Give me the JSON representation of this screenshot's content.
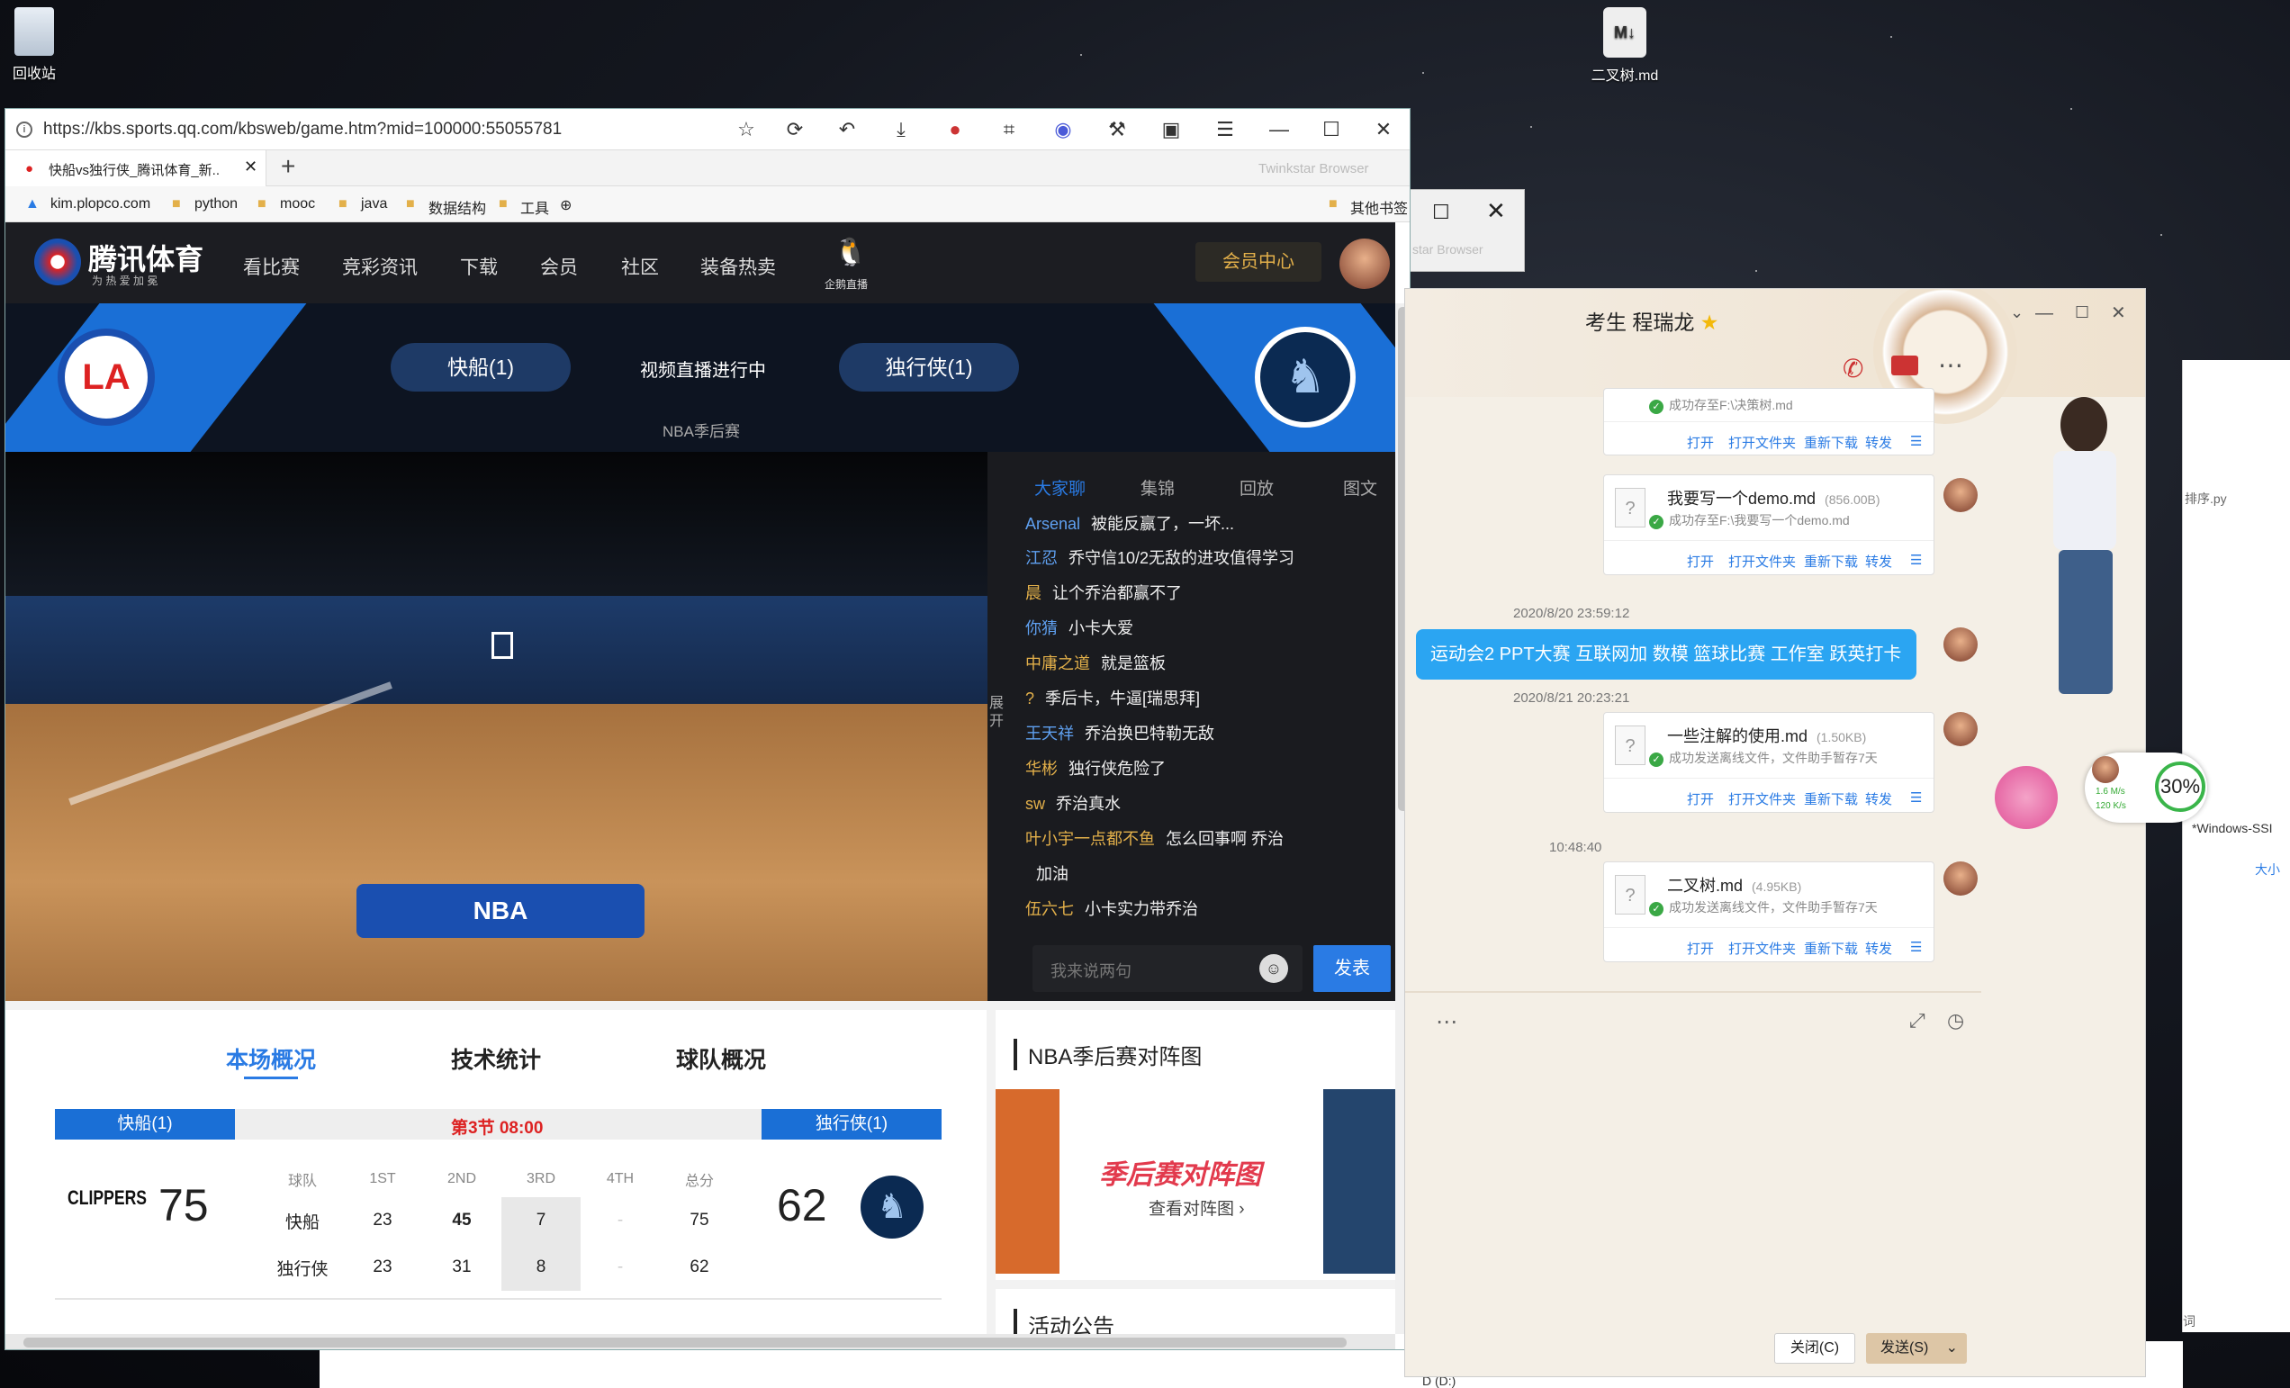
{
  "desktop": {
    "icons": [
      {
        "label": "回收站",
        "icon": "recycle-bin-icon"
      },
      {
        "label": "二叉树.md",
        "icon": "markdown-file-icon"
      }
    ]
  },
  "browser": {
    "url": "https://kbs.sports.qq.com/kbsweb/game.htm?mid=100000:55055781",
    "tab_title": "快船vs独行侠_腾讯体育_新...",
    "brand": "Twinkstar Browser",
    "bookmarks": [
      "kim.plopco.com",
      "python",
      "mooc",
      "java",
      "数据结构",
      "工具"
    ],
    "other_bookmarks": "其他书签"
  },
  "site": {
    "logo": "腾讯体育",
    "slogan": "为 热 爱 加 冕",
    "nav": [
      "看比赛",
      "竞彩资讯",
      "下载",
      "会员",
      "社区",
      "装备热卖"
    ],
    "live_label": "企鹅直播",
    "member_center": "会员中心",
    "home_team": "快船(1)",
    "away_team": "独行侠(1)",
    "live_status": "视频直播进行中",
    "stage": "NBA季后赛"
  },
  "chat": {
    "tabs": [
      "大家聊",
      "集锦",
      "回放",
      "图文"
    ],
    "expand": "展开",
    "messages": [
      {
        "user": "Arsenal",
        "text": "被能反赢了，一坏...",
        "gold": false
      },
      {
        "user": "江忍",
        "text": "乔守信10/2无敌的进攻值得学习",
        "gold": false
      },
      {
        "user": "晨",
        "text": "让个乔治都赢不了",
        "gold": true
      },
      {
        "user": "你猜",
        "text": "小卡大爱",
        "gold": false
      },
      {
        "user": "中庸之道",
        "text": "就是篮板",
        "gold": true
      },
      {
        "user": "?",
        "text": "季后卡，牛逼[瑞思拜]",
        "gold": true
      },
      {
        "user": "王天祥",
        "text": "乔治换巴特勒无敌",
        "gold": false
      },
      {
        "user": "华彬",
        "text": "独行侠危险了",
        "gold": true
      },
      {
        "user": "sw",
        "text": "乔治真水",
        "gold": true
      },
      {
        "user": "叶小宇一点都不鱼",
        "text": "怎么回事啊 乔治",
        "gold": true
      },
      {
        "user": "",
        "text": "加油",
        "gold": false
      },
      {
        "user": "伍六七",
        "text": "小卡实力带乔治",
        "gold": true
      }
    ],
    "input_placeholder": "我来说两句",
    "send": "发表"
  },
  "stats": {
    "tabs": [
      "本场概况",
      "技术统计",
      "球队概况"
    ],
    "period": "第3节 08:00",
    "home_bar": "快船(1)",
    "away_bar": "独行侠(1)",
    "home_score": "75",
    "away_score": "62",
    "home_logo": "CLIPPERS",
    "headers": [
      "球队",
      "1ST",
      "2ND",
      "3RD",
      "4TH",
      "总分"
    ],
    "rows": [
      [
        "快船",
        "23",
        "45",
        "7",
        "-",
        "75"
      ],
      [
        "独行侠",
        "23",
        "31",
        "8",
        "-",
        "62"
      ]
    ],
    "bracket_title": "NBA季后赛对阵图",
    "bracket_banner": "季后赛对阵图",
    "bracket_link": "查看对阵图 ›",
    "notice_title": "活动公告"
  },
  "qq": {
    "contact": "考生 程瑞龙",
    "files": [
      {
        "name": "",
        "size": "",
        "status": "成功存至F:\\决策树.md"
      },
      {
        "name": "我要写一个demo.md",
        "size": "(856.00B)",
        "status": "成功存至F:\\我要写一个demo.md"
      },
      {
        "name": "一些注解的使用.md",
        "size": "(1.50KB)",
        "status": "成功发送离线文件，文件助手暂存7天"
      },
      {
        "name": "二叉树.md",
        "size": "(4.95KB)",
        "status": "成功发送离线文件，文件助手暂存7天"
      }
    ],
    "actions": [
      "打开",
      "打开文件夹",
      "重新下载",
      "转发"
    ],
    "timestamps": [
      "2020/8/20 23:59:12",
      "2020/8/21 20:23:21",
      "10:48:40"
    ],
    "bubble": "运动会2 PPT大赛 互联网加 数模 篮球比赛 工作室 跃英打卡",
    "close_btn": "关闭(C)",
    "send_btn": "发送(S)",
    "speed_up": "1.6 M/s",
    "speed_down": "120 K/s",
    "percent": "30%"
  },
  "bg": {
    "side_text_1": "排序.py",
    "side_text_2": "*Windows-SSI",
    "side_text_3": "大小",
    "side_text_4": "词",
    "taskbar_drive": "D (D:)",
    "ghost_brand": "star Browser"
  },
  "colors": {
    "accent": "#1a6fd6",
    "gold": "#e3b04a",
    "qq_bubble": "#2ba5f2",
    "period_red": "#d22"
  }
}
